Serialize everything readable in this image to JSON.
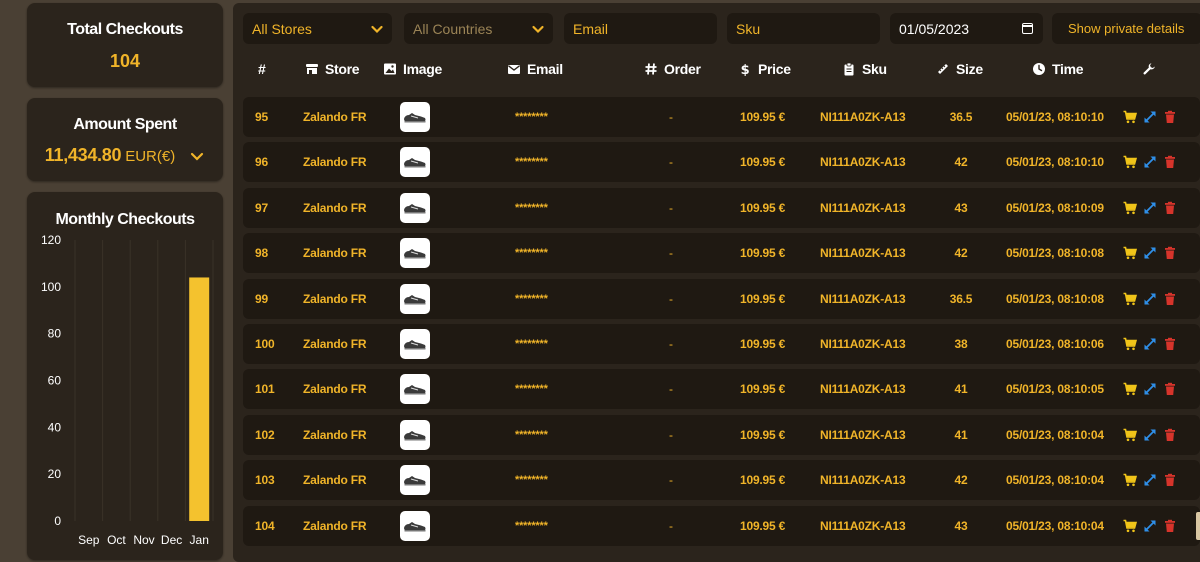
{
  "stats": {
    "total_checkouts": {
      "title": "Total Checkouts",
      "value": "104"
    },
    "amount_spent": {
      "title": "Amount Spent",
      "value": "11,434.80",
      "currency": "EUR(€)"
    },
    "monthly_checkouts": {
      "title": "Monthly Checkouts"
    }
  },
  "chart_data": {
    "type": "bar",
    "categories": [
      "Sep",
      "Oct",
      "Nov",
      "Dec",
      "Jan"
    ],
    "values": [
      0,
      0,
      0,
      0,
      104
    ],
    "yticks": [
      "120",
      "100",
      "80",
      "60",
      "40",
      "20",
      "0"
    ],
    "ylim": [
      0,
      120
    ],
    "bar_color": "#f4c22e"
  },
  "filters": {
    "stores": "All Stores",
    "countries": "All Countries",
    "email_placeholder": "Email",
    "sku_placeholder": "Sku",
    "date": "01/05/2023",
    "private_button": "Show private details"
  },
  "table": {
    "headers": {
      "num": "#",
      "store": "Store",
      "image": "Image",
      "email": "Email",
      "order": "Order",
      "price": "Price",
      "sku": "Sku",
      "size": "Size",
      "time": "Time"
    },
    "rows": [
      {
        "num": "95",
        "store": "Zalando FR",
        "email": "********",
        "order": "-",
        "price": "109.95 €",
        "sku": "NI111A0ZK-A13",
        "size": "36.5",
        "time": "05/01/23, 08:10:10"
      },
      {
        "num": "96",
        "store": "Zalando FR",
        "email": "********",
        "order": "-",
        "price": "109.95 €",
        "sku": "NI111A0ZK-A13",
        "size": "42",
        "time": "05/01/23, 08:10:10"
      },
      {
        "num": "97",
        "store": "Zalando FR",
        "email": "********",
        "order": "-",
        "price": "109.95 €",
        "sku": "NI111A0ZK-A13",
        "size": "43",
        "time": "05/01/23, 08:10:09"
      },
      {
        "num": "98",
        "store": "Zalando FR",
        "email": "********",
        "order": "-",
        "price": "109.95 €",
        "sku": "NI111A0ZK-A13",
        "size": "42",
        "time": "05/01/23, 08:10:08"
      },
      {
        "num": "99",
        "store": "Zalando FR",
        "email": "********",
        "order": "-",
        "price": "109.95 €",
        "sku": "NI111A0ZK-A13",
        "size": "36.5",
        "time": "05/01/23, 08:10:08"
      },
      {
        "num": "100",
        "store": "Zalando FR",
        "email": "********",
        "order": "-",
        "price": "109.95 €",
        "sku": "NI111A0ZK-A13",
        "size": "38",
        "time": "05/01/23, 08:10:06"
      },
      {
        "num": "101",
        "store": "Zalando FR",
        "email": "********",
        "order": "-",
        "price": "109.95 €",
        "sku": "NI111A0ZK-A13",
        "size": "41",
        "time": "05/01/23, 08:10:05"
      },
      {
        "num": "102",
        "store": "Zalando FR",
        "email": "********",
        "order": "-",
        "price": "109.95 €",
        "sku": "NI111A0ZK-A13",
        "size": "41",
        "time": "05/01/23, 08:10:04"
      },
      {
        "num": "103",
        "store": "Zalando FR",
        "email": "********",
        "order": "-",
        "price": "109.95 €",
        "sku": "NI111A0ZK-A13",
        "size": "42",
        "time": "05/01/23, 08:10:04"
      },
      {
        "num": "104",
        "store": "Zalando FR",
        "email": "********",
        "order": "-",
        "price": "109.95 €",
        "sku": "NI111A0ZK-A13",
        "size": "43",
        "time": "05/01/23, 08:10:04"
      }
    ]
  },
  "icons": {
    "store": "store-icon",
    "image": "image-icon",
    "email": "envelope-icon",
    "order": "hash-icon",
    "price": "dollar-icon",
    "sku": "clipboard-icon",
    "size": "ruler-icon",
    "time": "clock-icon",
    "actions": "wrench-icon",
    "row_actions": [
      "cart-icon",
      "expand-icon",
      "trash-icon"
    ],
    "row_image": "sneaker-icon"
  },
  "colors": {
    "accent": "#f0b429",
    "cart": "#f0c419",
    "expand": "#2f8fe8",
    "trash": "#d6342b"
  }
}
